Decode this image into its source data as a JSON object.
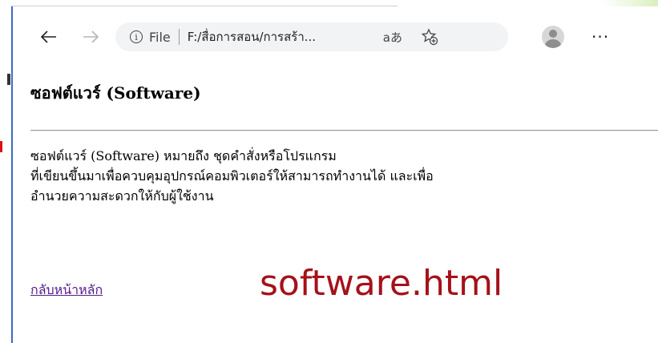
{
  "browser": {
    "scheme_label": "File",
    "url": "F:/สื่อการสอน/การสร้า...",
    "read_aloud_label": "aあ",
    "more_label": "···",
    "back_icon": "arrow-left-icon",
    "forward_icon": "arrow-right-icon"
  },
  "page": {
    "title": "ซอฟต์แวร์ (Software)",
    "description_line1": "ซอฟต์แวร์ (Software) หมายถึง ชุดคำสั่งหรือโปรแกรม",
    "description_line2": "ที่เขียนขึ้นมาเพื่อควบคุมอุปกรณ์คอมพิวเตอร์ให้สามารถทำงานได้ และเพื่อ",
    "description_line3": "อำนวยความสะดวกให้กับผู้ใช้งาน",
    "back_link": "กลับหน้าหลัก"
  },
  "annotation": {
    "filename": "software.html",
    "color": "#a5111a"
  }
}
